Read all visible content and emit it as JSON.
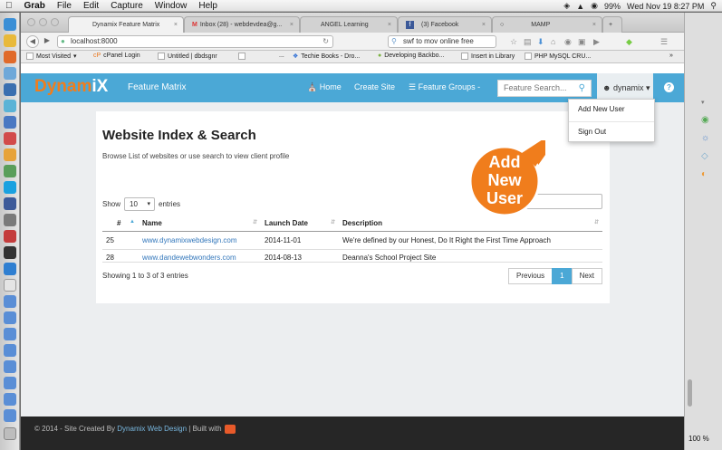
{
  "menubar": {
    "apple_icon": "apple-icon",
    "app": "Grab",
    "menus": [
      "File",
      "Edit",
      "Capture",
      "Window",
      "Help"
    ],
    "battery": "99%",
    "datetime": "Wed Nov 19  8:27 PM"
  },
  "browser": {
    "tabs": [
      {
        "label": "Dynamix Feature Matrix",
        "active": true
      },
      {
        "label": "Inbox (28) - webdevdea@g...",
        "active": false
      },
      {
        "label": "ANGEL Learning",
        "active": false
      },
      {
        "label": "(3) Facebook",
        "active": false
      },
      {
        "label": "MAMP",
        "active": false
      }
    ],
    "url": "localhost:8000",
    "search_value": "swf to mov online free",
    "bookmarks": [
      "Most Visited",
      "cPanel Login",
      "Untitled | dbdsgnr",
      "Techie Books - Dro...",
      "Developing Backbo...",
      "Insert in Library",
      "PHP MySQL CRU..."
    ]
  },
  "app": {
    "brand_part1": "Dynam",
    "brand_part2": "iX",
    "subtitle": "Feature Matrix",
    "nav": {
      "home": "Home",
      "create_site": "Create Site",
      "feature_groups": "Feature Groups -"
    },
    "search_placeholder": "Feature Search...",
    "user": "dynamix",
    "user_menu": {
      "add_new_user": "Add New User",
      "sign_out": "Sign Out"
    },
    "colors": {
      "navbar": "#4ba8d6",
      "brand": "#f07d1c",
      "callout": "#f07d1c"
    }
  },
  "page": {
    "title": "Website Index & Search",
    "lead": "Browse List of websites or use search to view client profile",
    "length_prefix": "Show",
    "length_value": "10",
    "length_suffix": "entries",
    "table": {
      "columns": [
        "#",
        "Name",
        "Launch Date",
        "Description"
      ],
      "rows": [
        {
          "id": "25",
          "name": "www.dynamixwebdesign.com",
          "date": "2014-11-01",
          "desc": "We're defined by our Honest, Do It Right the First Time Approach"
        },
        {
          "id": "28",
          "name": "www.dandewebwonders.com",
          "date": "2014-08-13",
          "desc": "Deanna's School Project Site"
        }
      ]
    },
    "info": "Showing 1 to 3 of 3 entries",
    "pager": {
      "prev": "Previous",
      "current": "1",
      "next": "Next"
    }
  },
  "callout": {
    "text": "Add\nNew\nUser"
  },
  "footer": {
    "prefix": "© 2014 - Site Created By ",
    "link": "Dynamix Web Design",
    "suffix": " | Built with"
  },
  "statusbar": {
    "zoom": "100 %"
  }
}
